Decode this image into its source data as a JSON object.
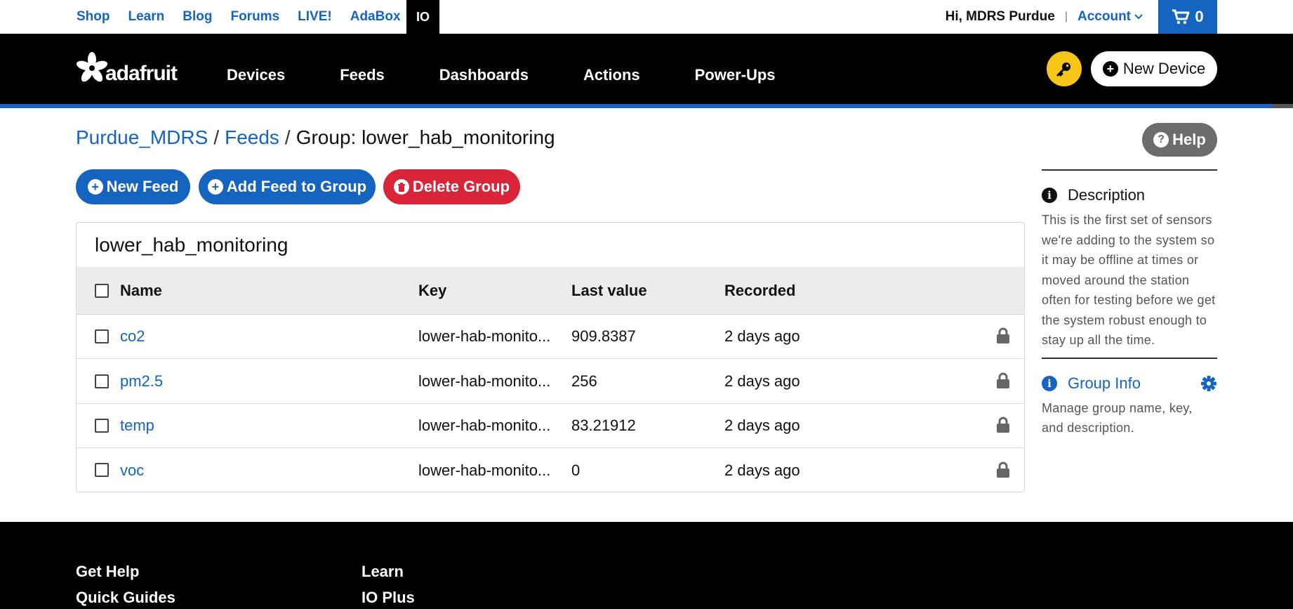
{
  "topbar": {
    "links": [
      "Shop",
      "Learn",
      "Blog",
      "Forums",
      "LIVE!",
      "AdaBox"
    ],
    "active_tab": "IO",
    "greeting": "Hi, MDRS Purdue",
    "separator": "|",
    "account_label": "Account",
    "cart_count": "0"
  },
  "nav": {
    "logo_text": "adafruit",
    "items": [
      "Devices",
      "Feeds",
      "Dashboards",
      "Actions",
      "Power-Ups"
    ],
    "new_device_label": "New Device"
  },
  "breadcrumb": {
    "user": "Purdue_MDRS",
    "feeds": "Feeds",
    "current": "Group: lower_hab_monitoring"
  },
  "help_label": "Help",
  "actions": {
    "new_feed": "New Feed",
    "add_feed": "Add Feed to Group",
    "delete_group": "Delete Group"
  },
  "table": {
    "title": "lower_hab_monitoring",
    "headers": {
      "name": "Name",
      "key": "Key",
      "last": "Last value",
      "recorded": "Recorded"
    },
    "rows": [
      {
        "name": "co2",
        "key": "lower-hab-monito...",
        "last": "909.8387",
        "recorded": "2 days ago"
      },
      {
        "name": "pm2.5",
        "key": "lower-hab-monito...",
        "last": "256",
        "recorded": "2 days ago"
      },
      {
        "name": "temp",
        "key": "lower-hab-monito...",
        "last": "83.21912",
        "recorded": "2 days ago"
      },
      {
        "name": "voc",
        "key": "lower-hab-monito...",
        "last": "0",
        "recorded": "2 days ago"
      }
    ]
  },
  "sidebar": {
    "description_title": "Description",
    "description_text": "This is the first set of sensors we're adding to the system so it may be offline at times or moved around the station often for testing before we get the system robust enough to stay up all the time.",
    "group_info_title": "Group Info",
    "group_info_text": "Manage group name, key, and description."
  },
  "footer": {
    "col1": [
      "Get Help",
      "Quick Guides"
    ],
    "col2": [
      "Learn",
      "IO Plus"
    ]
  },
  "colors": {
    "brand_blue": "#1565c0",
    "danger_red": "#d9243a",
    "key_yellow": "#f5c518",
    "help_gray": "#6c6c6c"
  }
}
